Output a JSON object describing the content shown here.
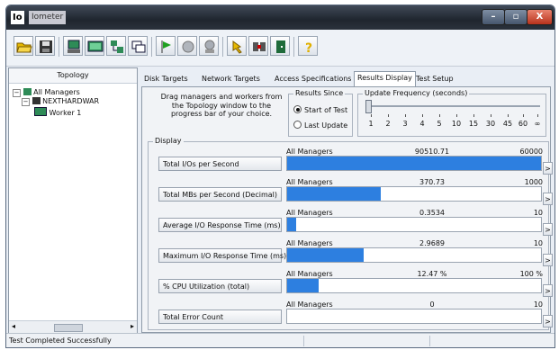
{
  "window": {
    "app_logo": "Io",
    "app_name": "Iometer",
    "min": "–",
    "max": "▫",
    "close": "X"
  },
  "toolbar": {
    "items": [
      {
        "icon": "open-folder-icon"
      },
      {
        "icon": "save-disk-icon"
      },
      {
        "icon": "new-worker-icon"
      },
      {
        "icon": "new-disk-worker-icon"
      },
      {
        "icon": "new-manager-icon"
      },
      {
        "icon": "copy-worker-icon"
      },
      {
        "icon": "start-flag-icon"
      },
      {
        "icon": "stop-icon"
      },
      {
        "icon": "stop-all-icon"
      },
      {
        "icon": "reset-workers-icon"
      },
      {
        "icon": "disconnect-icon"
      },
      {
        "icon": "exit-icon"
      },
      {
        "icon": "help-icon"
      }
    ]
  },
  "topology": {
    "title": "Topology",
    "tree": [
      "All Managers",
      "NEXTHARDWAR",
      "Worker 1"
    ]
  },
  "tabs": [
    "Disk Targets",
    "Network Targets",
    "Access Specifications",
    "Results Display",
    "Test Setup"
  ],
  "active_tab": "Results Display",
  "results": {
    "help_text": "Drag managers and workers from the Topology window to the progress bar of your choice.",
    "results_since": {
      "title": "Results Since",
      "options": [
        "Start of Test",
        "Last Update"
      ],
      "selected": "Start of Test"
    },
    "update_frequency": {
      "title": "Update Frequency (seconds)",
      "ticks": [
        "1",
        "2",
        "3",
        "4",
        "5",
        "10",
        "15",
        "30",
        "45",
        "60",
        "∞"
      ]
    },
    "display_title": "Display",
    "metrics": [
      {
        "label": "Total I/Os per Second",
        "manager": "All Managers",
        "value": "90510.71",
        "max": "60000",
        "fill": 1.0
      },
      {
        "label": "Total MBs per Second (Decimal)",
        "manager": "All Managers",
        "value": "370.73",
        "max": "1000",
        "fill": 0.37
      },
      {
        "label": "Average I/O Response Time (ms)",
        "manager": "All Managers",
        "value": "0.3534",
        "max": "10",
        "fill": 0.035
      },
      {
        "label": "Maximum I/O Response Time (ms)",
        "manager": "All Managers",
        "value": "2.9689",
        "max": "10",
        "fill": 0.3
      },
      {
        "label": "% CPU Utilization (total)",
        "manager": "All Managers",
        "value": "12.47 %",
        "max": "100 %",
        "fill": 0.125
      },
      {
        "label": "Total Error Count",
        "manager": "All Managers",
        "value": "0",
        "max": "10",
        "fill": 0.0
      }
    ],
    "arrow": ">"
  },
  "status": {
    "text": "Test Completed Successfully"
  },
  "colors": {
    "bar": "#2d7fe0",
    "titlebar": "#1f252e"
  }
}
